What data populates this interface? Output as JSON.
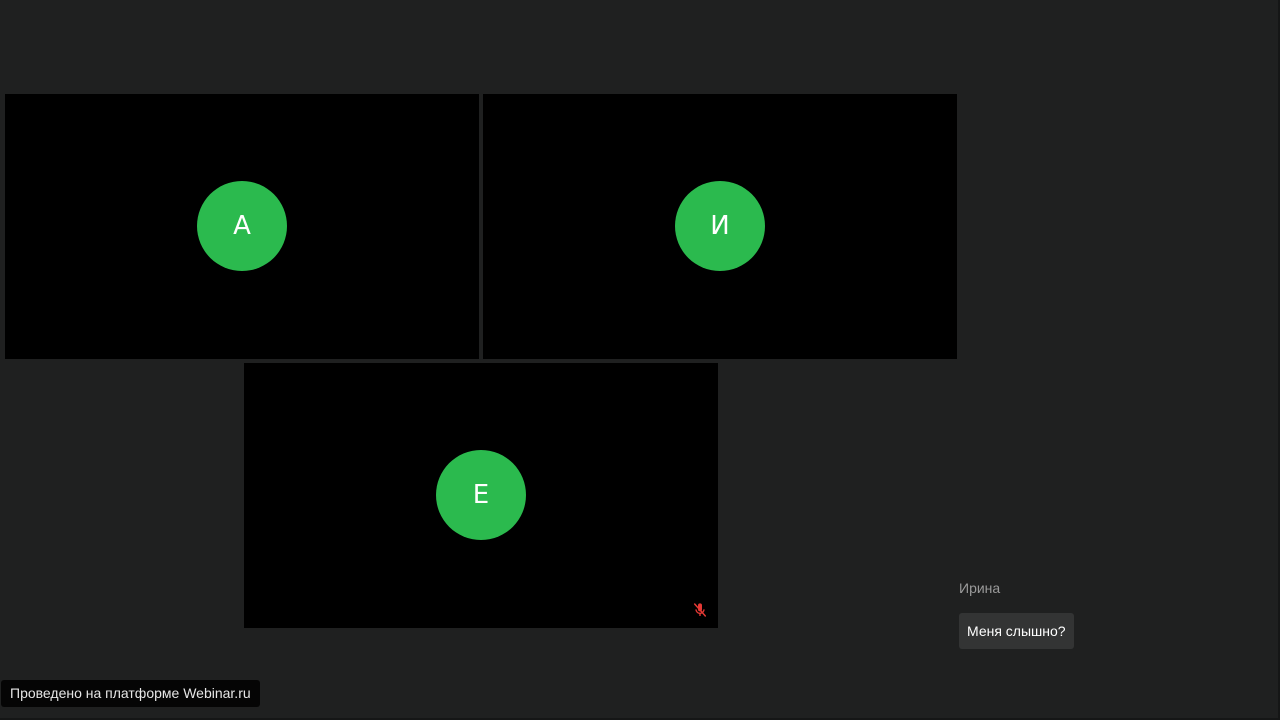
{
  "colors": {
    "background": "#1f2020",
    "tile": "#000000",
    "avatar": "#2bba4e",
    "muted_icon": "#e53935"
  },
  "participants": [
    {
      "initial": "А"
    },
    {
      "initial": "И"
    },
    {
      "initial": "Е",
      "muted_icon": "mic-off-icon"
    }
  ],
  "chat": {
    "author": "Ирина",
    "message": "Меня слышно?"
  },
  "footer": {
    "badge": "Проведено на платформе Webinar.ru"
  }
}
